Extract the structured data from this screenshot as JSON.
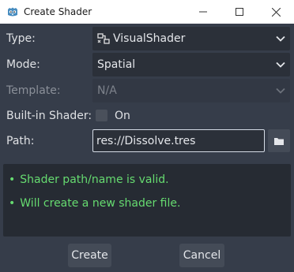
{
  "window": {
    "title": "Create Shader"
  },
  "titlebar": {
    "icons": [
      "godot-logo-icon",
      "minimize-icon",
      "maximize-icon",
      "close-icon"
    ]
  },
  "form": {
    "type": {
      "label": "Type:",
      "value": "VisualShader",
      "icon": "visual-shader-icon"
    },
    "mode": {
      "label": "Mode:",
      "value": "Spatial"
    },
    "template": {
      "label": "Template:",
      "value": "N/A",
      "disabled": true
    },
    "builtin": {
      "label": "Built-in Shader:",
      "checkbox_label": "On",
      "checked": false
    },
    "path": {
      "label": "Path:",
      "value": "res://Dissolve.tres",
      "button_icon": "folder-icon"
    }
  },
  "status": {
    "lines": [
      {
        "bullet": "•",
        "text": "Shader path/name is valid."
      },
      {
        "bullet": "•",
        "text": "Will create a new shader file."
      }
    ],
    "color": "#66db70"
  },
  "actions": {
    "create_label": "Create",
    "cancel_label": "Cancel"
  },
  "colors": {
    "background": "#363d4a",
    "field": "#2b3039",
    "accent_border": "#d5dce6",
    "valid_text": "#66db70"
  }
}
